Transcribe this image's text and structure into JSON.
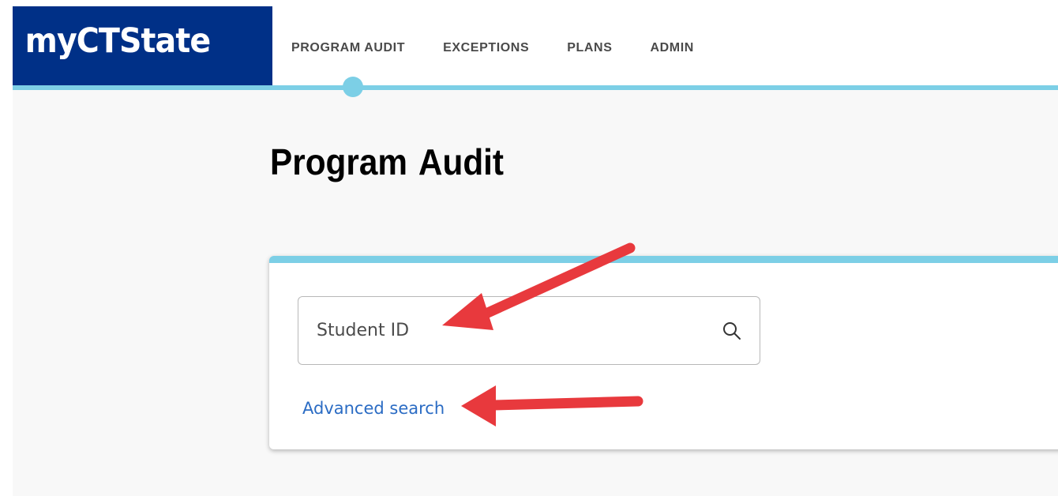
{
  "header": {
    "logo": "myCTState",
    "nav": [
      {
        "label": "PROGRAM AUDIT"
      },
      {
        "label": "EXCEPTIONS"
      },
      {
        "label": "PLANS"
      },
      {
        "label": "ADMIN"
      }
    ],
    "active_tab": "PROGRAM AUDIT"
  },
  "main": {
    "title": "Program Audit",
    "search": {
      "placeholder": "Student ID",
      "value": "",
      "icon": "search-icon"
    },
    "advanced_search_label": "Advanced search"
  },
  "colors": {
    "brand": "#003087",
    "accent": "#7ccfe6",
    "link": "#2b6cc4",
    "annotation_arrow": "#e8393d"
  }
}
